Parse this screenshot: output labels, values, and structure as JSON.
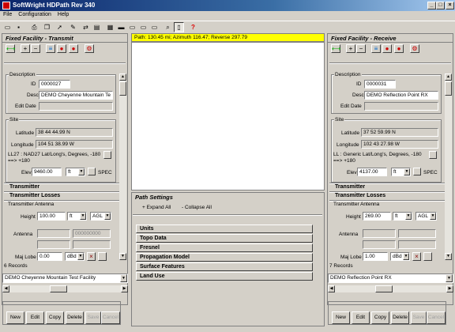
{
  "window": {
    "title": "SoftWright HDPath Rev 340"
  },
  "menu": [
    "File",
    "Configuration",
    "Help"
  ],
  "path_info": "Path: 130.45 mi; Azimuth 116.47; Reverse 297.79",
  "transmit": {
    "header": "Fixed Facility - Transmit",
    "description_group": "Description",
    "id_label": "ID",
    "id": "0000027",
    "desc_label": "Desc",
    "desc": "DEMO Cheyenne Mountain Te",
    "edit_date_label": "Edit Date",
    "edit_date": "",
    "site_group": "Site",
    "lat_label": "Latitude",
    "lat": "38 44 44.99 N",
    "lon_label": "Longitude",
    "lon": "104 51 38.99 W",
    "datum": "LL27 : NAD27 Lat/Long's, Degrees, -180 ==> +180",
    "elev_label": "Elev",
    "elev": "9460.00",
    "elev_unit": "ft",
    "spec": "SPEC",
    "transmitter": "Transmitter",
    "transmitter_losses": "Transmitter Losses",
    "antenna_group": "Transmitter Antenna",
    "height_label": "Height",
    "height": "100.00",
    "height_unit": "ft",
    "height_ref": "AGL",
    "antenna_label": "Antenna",
    "antenna_code": "000000000",
    "maj_lobe_label": "Maj Lobe",
    "maj_lobe": "0.00",
    "maj_lobe_unit": "dBd",
    "records": "6 Records",
    "record_select": "DEMO Cheyenne Mountain Test Facility"
  },
  "receive": {
    "header": "Fixed Facility - Receive",
    "description_group": "Description",
    "id_label": "ID",
    "id": "0000031",
    "desc_label": "Desc",
    "desc": "DEMO Reflection Point RX",
    "edit_date_label": "Edit Date",
    "edit_date": "",
    "site_group": "Site",
    "lat_label": "Latitude",
    "lat": "37 52 59.99 N",
    "lon_label": "Longitude",
    "lon": "102 43 27.98 W",
    "datum": "LL : Generic Lat/Long's, Degrees, -180 ==> +180",
    "elev_label": "Elev",
    "elev": "4137.00",
    "elev_unit": "ft",
    "spec": "SPEC",
    "transmitter": "Transmitter",
    "transmitter_losses": "Transmitter Losses",
    "antenna_group": "Transmitter Antenna",
    "height_label": "Height",
    "height": "269.00",
    "height_unit": "ft",
    "height_ref": "AGL",
    "antenna_label": "Antenna",
    "antenna_code": "",
    "maj_lobe_label": "Maj Lobe",
    "maj_lobe": "1.00",
    "maj_lobe_unit": "dBd",
    "records": "7 Records",
    "record_select": "DEMO Reflection Point RX"
  },
  "buttons": [
    "New",
    "Edit",
    "Copy",
    "Delete",
    "Save",
    "Cancel"
  ],
  "path_settings": {
    "header": "Path Settings",
    "expand": "+ Expand All",
    "collapse": "- Collapse All",
    "sections": [
      "Units",
      "Topo Data",
      "Fresnel",
      "Propagation Model",
      "Surface Features",
      "Land Use"
    ]
  },
  "colors": {
    "path_bar": "#ffff00",
    "title_bar": "#0a246a"
  }
}
